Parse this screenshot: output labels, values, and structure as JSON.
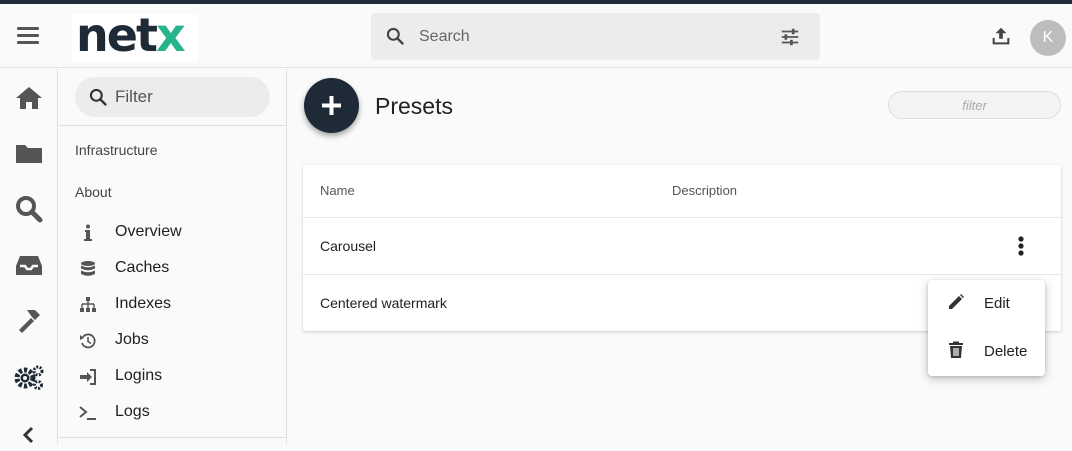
{
  "header": {
    "logo_text": "net",
    "logo_accent": "x",
    "search_placeholder": "Search",
    "avatar_initial": "K"
  },
  "rail": {
    "icons": [
      "home-icon",
      "folder-icon",
      "search-icon",
      "inbox-icon",
      "hammer-icon",
      "gears-icon",
      "chevron-left-icon"
    ]
  },
  "sidebar": {
    "filter_placeholder": "Filter",
    "sections": [
      "Infrastructure",
      "About"
    ],
    "items": [
      {
        "label": "Overview",
        "icon": "info-icon"
      },
      {
        "label": "Caches",
        "icon": "database-icon"
      },
      {
        "label": "Indexes",
        "icon": "sitemap-icon"
      },
      {
        "label": "Jobs",
        "icon": "history-icon"
      },
      {
        "label": "Logins",
        "icon": "sign-in-icon"
      },
      {
        "label": "Logs",
        "icon": "terminal-icon"
      }
    ]
  },
  "main": {
    "title": "Presets",
    "filter_placeholder": "filter",
    "table": {
      "columns": [
        "Name",
        "Description"
      ],
      "rows": [
        {
          "name": "Carousel",
          "description": ""
        },
        {
          "name": "Centered watermark",
          "description": ""
        }
      ]
    }
  },
  "context_menu": {
    "items": [
      {
        "label": "Edit",
        "icon": "pencil-icon"
      },
      {
        "label": "Delete",
        "icon": "trash-icon"
      }
    ]
  },
  "colors": {
    "brand_dark": "#1f2a37",
    "brand_green": "#27b38b",
    "icon_gray": "#555555"
  }
}
